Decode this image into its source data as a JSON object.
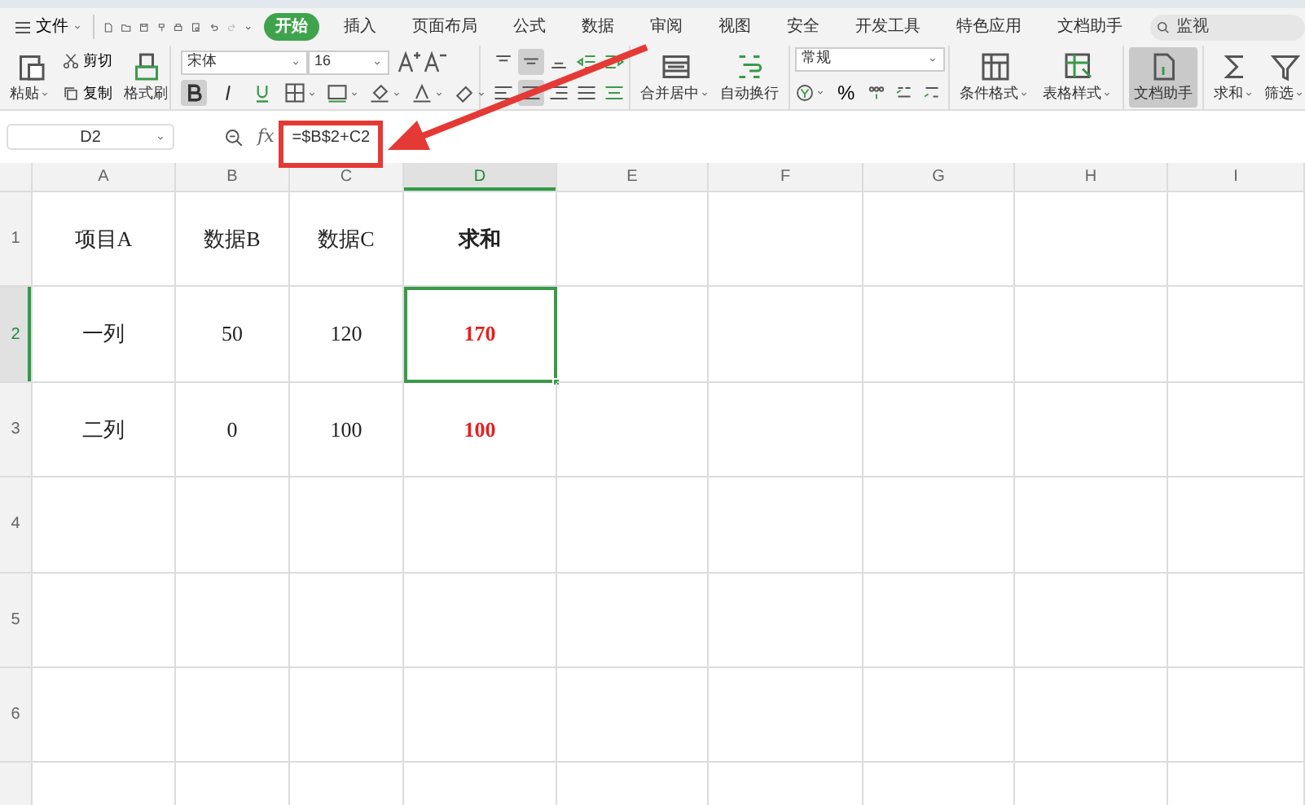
{
  "menu": {
    "label": "文件"
  },
  "tabs": [
    {
      "label": "开始",
      "selected": true
    },
    {
      "label": "插入",
      "selected": false
    },
    {
      "label": "页面布局",
      "selected": false
    },
    {
      "label": "公式",
      "selected": false
    },
    {
      "label": "数据",
      "selected": false
    },
    {
      "label": "审阅",
      "selected": false
    },
    {
      "label": "视图",
      "selected": false
    },
    {
      "label": "安全",
      "selected": false
    },
    {
      "label": "开发工具",
      "selected": false
    },
    {
      "label": "特色应用",
      "selected": false
    },
    {
      "label": "文档助手",
      "selected": false
    }
  ],
  "search": {
    "placeholder": "监视"
  },
  "ribbon": {
    "clipboard": {
      "paste": "粘贴",
      "cut": "剪切",
      "copy": "复制",
      "painter": "格式刷"
    },
    "font": {
      "name": "宋体",
      "size": "16",
      "bold": true,
      "italic": false,
      "underline": false
    },
    "align": [
      {
        "selected": false
      },
      {
        "selected": true
      },
      {
        "selected": false
      },
      {
        "selected": false
      },
      {
        "selected": false
      },
      {
        "selected": false
      },
      {
        "selected": true
      },
      {
        "selected": false
      },
      {
        "selected": false
      },
      {
        "selected": false
      }
    ],
    "merge": "合并居中",
    "wrap": "自动换行",
    "number": {
      "format": "常规",
      "percent": "%"
    },
    "tools": [
      {
        "label": "条件格式",
        "dropdown": true,
        "selected": false
      },
      {
        "label": "表格样式",
        "dropdown": true,
        "selected": false
      },
      {
        "label": "文档助手",
        "dropdown": false,
        "selected": true
      },
      {
        "label": "求和",
        "dropdown": true,
        "selected": false
      },
      {
        "label": "筛选",
        "dropdown": true,
        "selected": false
      }
    ]
  },
  "name_box": "D2",
  "fx": "fx",
  "formula": "=$B$2+C2",
  "sheet": {
    "columns": [
      {
        "label": "A",
        "selected": false
      },
      {
        "label": "B",
        "selected": false
      },
      {
        "label": "C",
        "selected": false
      },
      {
        "label": "D",
        "selected": true
      },
      {
        "label": "E",
        "selected": false
      },
      {
        "label": "F",
        "selected": false
      },
      {
        "label": "G",
        "selected": false
      },
      {
        "label": "H",
        "selected": false
      },
      {
        "label": "I",
        "selected": false
      }
    ],
    "rows": [
      {
        "label": "1",
        "selected": false,
        "cells": [
          {
            "text": "项目A",
            "kind": "plain",
            "active": false
          },
          {
            "text": "数据B",
            "kind": "plain",
            "active": false
          },
          {
            "text": "数据C",
            "kind": "plain",
            "active": false
          },
          {
            "text": "求和",
            "kind": "bold",
            "active": false
          }
        ]
      },
      {
        "label": "2",
        "selected": true,
        "cells": [
          {
            "text": "一列",
            "kind": "plain",
            "active": false
          },
          {
            "text": "50",
            "kind": "plain",
            "active": false
          },
          {
            "text": "120",
            "kind": "plain",
            "active": false
          },
          {
            "text": "170",
            "kind": "result",
            "active": true
          }
        ]
      },
      {
        "label": "3",
        "selected": false,
        "cells": [
          {
            "text": "二列",
            "kind": "plain",
            "active": false
          },
          {
            "text": "0",
            "kind": "plain",
            "active": false
          },
          {
            "text": "100",
            "kind": "plain",
            "active": false
          },
          {
            "text": "100",
            "kind": "result",
            "active": false
          }
        ]
      },
      {
        "label": "4",
        "selected": false
      },
      {
        "label": "5",
        "selected": false
      },
      {
        "label": "6",
        "selected": false
      }
    ]
  }
}
